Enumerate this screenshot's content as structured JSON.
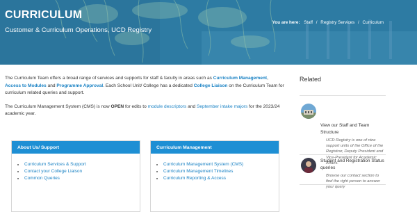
{
  "hero": {
    "title": "CURRICULUM",
    "subtitle": "Customer & Curriculum Operations, UCD Registry",
    "breadcrumb": {
      "label": "You are here:",
      "items": [
        "Staff",
        "Registry Services",
        "Curriculum"
      ],
      "separator": "/"
    }
  },
  "intro": {
    "p1": {
      "t1": "The Curriculum Team offers a broad range of services and supports for staff & faculty in areas such as ",
      "l1": "Curriculum Management",
      "t2": ", ",
      "l2": "Access to Modules",
      "t3": " and ",
      "l3": "Programme Approval",
      "t4": ". Each School Unit/ College has a dedicated ",
      "l4": "College Liaison",
      "t5": " on the Curriculum Team for curriculum related queries and support."
    },
    "p2": {
      "t1": "The Curriculum Management System (CMS) is now ",
      "b1": "OPEN",
      "t2": " for edits to ",
      "l1": "module descriptors",
      "t3": " and ",
      "l2": "September intake majors",
      "t4": " for the 2023/24 academic year."
    }
  },
  "cards": [
    {
      "title": "About Us/ Support",
      "links": [
        "Curriculum Services & Support",
        "Contact your College Liaison",
        "Common Queries"
      ]
    },
    {
      "title": "Curriculum Management",
      "links": [
        "Curriculum Management System (CMS)",
        "Curriculum Management Timelines",
        "Curriculum Reporting & Access"
      ]
    }
  ],
  "sidebar": {
    "title": "Related",
    "items": [
      {
        "title": "View our Staff and Team Structure",
        "desc": "UCD Registry is one of nine support units of the Office of the Registrar, Deputy President and Vice-President for Academic Affairs."
      },
      {
        "title": "Student and Registration Status queries",
        "desc": "Browse our contact section to find the right person to answer your query"
      }
    ]
  },
  "colors": {
    "link": "#1a82c4",
    "card_header": "#1e8fd4",
    "hero": "#2a7aa3"
  }
}
